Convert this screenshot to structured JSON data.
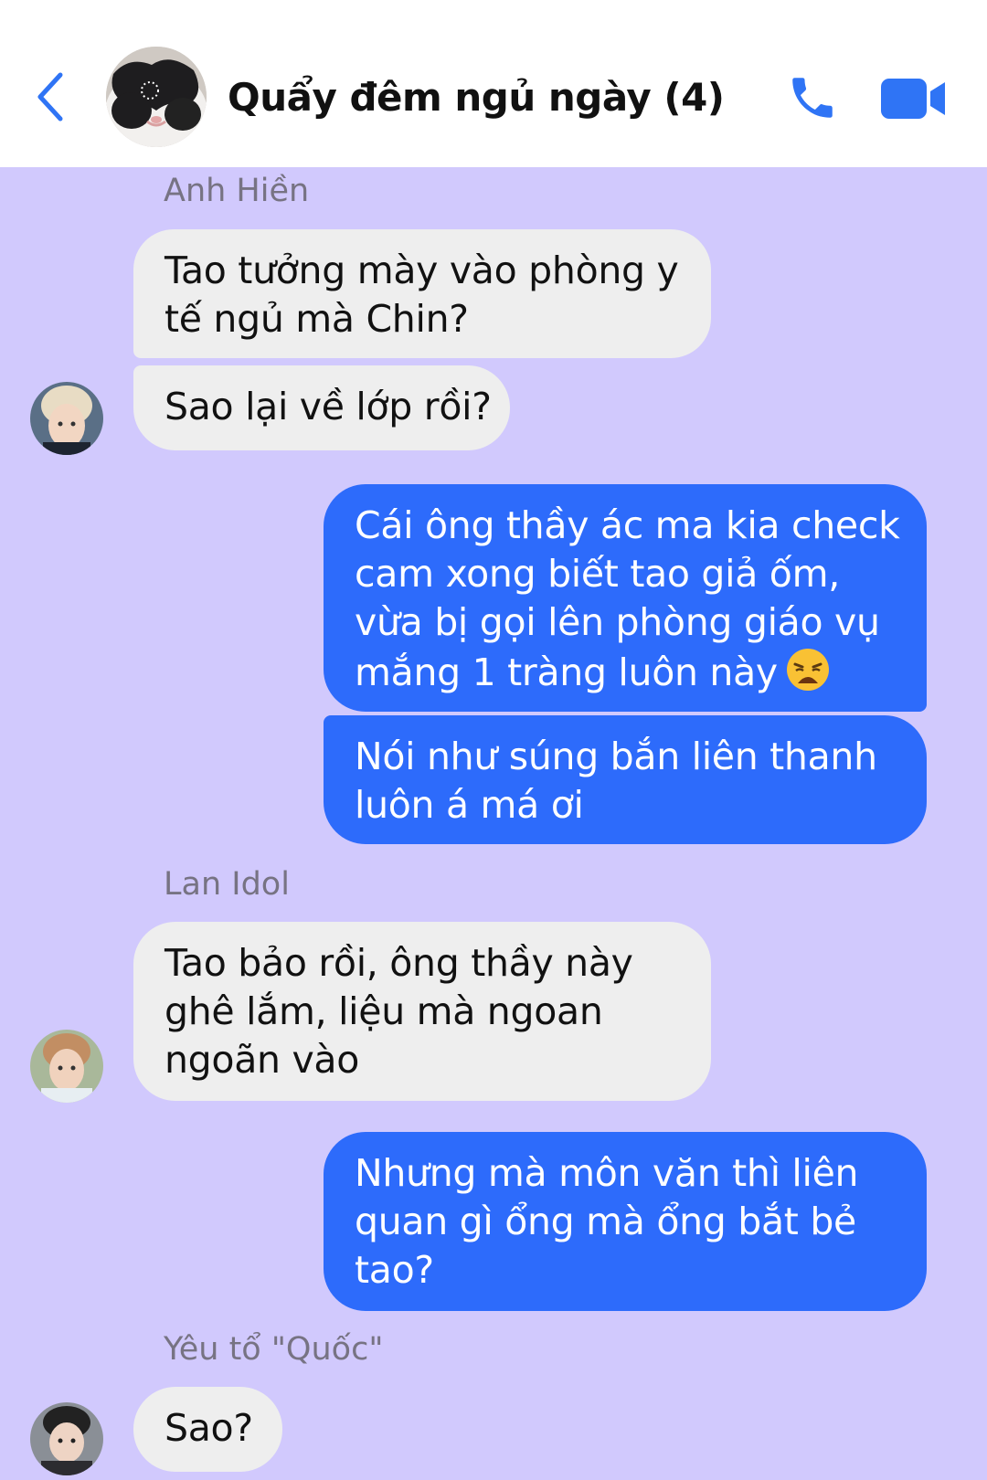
{
  "header": {
    "title": "Quẩy đêm ngủ ngày (4)"
  },
  "messages": [
    {
      "sender": "Anh Hiền",
      "bubbles": [
        [
          "Tao tưởng mày vào phòng y",
          "tế ngủ mà Chin?"
        ],
        [
          "Sao lại về lớp rồi?"
        ]
      ]
    },
    {
      "sender": "Me",
      "bubbles": [
        [
          "Cái ông thầy ác ma kia check",
          "cam xong biết tao giả ốm,",
          "vừa bị gọi lên phòng giáo vụ",
          "mắng 1 tràng luôn này"
        ],
        [
          "Nói như súng bắn liên thanh",
          "luôn á má ơi"
        ]
      ],
      "emoji": "weary-face-emoji"
    },
    {
      "sender": "Lan Idol",
      "bubbles": [
        [
          "Tao bảo rồi, ông thầy này",
          "ghê lắm, liệu mà ngoan",
          "ngoãn vào"
        ]
      ]
    },
    {
      "sender": "Me",
      "bubbles": [
        [
          "Nhưng mà môn văn thì liên",
          "quan gì ổng mà ổng bắt bẻ",
          "tao?"
        ]
      ]
    },
    {
      "sender": "Yêu tổ \"Quốc\"",
      "bubbles": [
        [
          "Sao?"
        ]
      ]
    }
  ],
  "colors": {
    "background": "#d1c9fd",
    "incoming_bubble": "#eeeeee",
    "outgoing_bubble": "#2d6bfb",
    "accent": "#2f74f5"
  }
}
